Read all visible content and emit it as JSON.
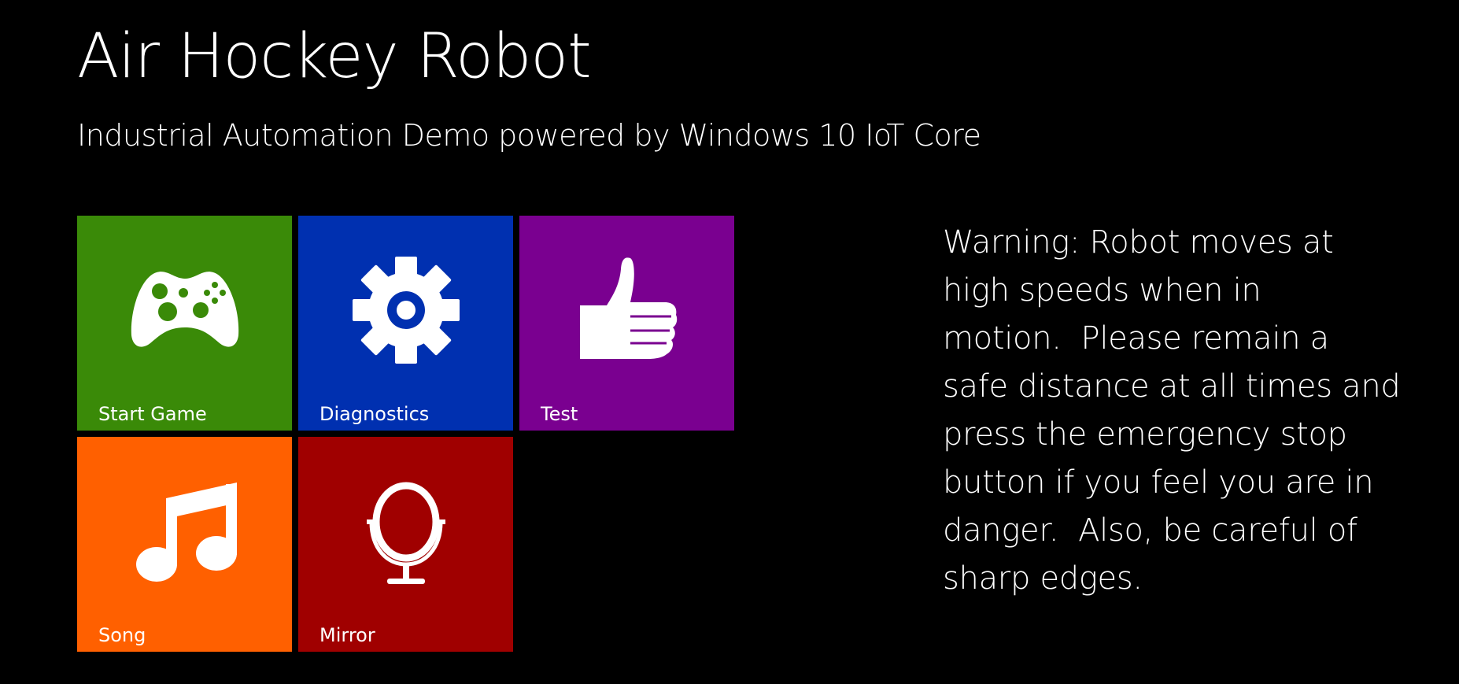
{
  "header": {
    "title": "Air Hockey Robot",
    "subtitle": "Industrial Automation Demo powered by Windows 10 IoT Core"
  },
  "tiles": [
    {
      "label": "Start Game",
      "icon": "gamepad-icon",
      "color": "#3a8a08"
    },
    {
      "label": "Diagnostics",
      "icon": "gear-icon",
      "color": "#0030b0"
    },
    {
      "label": "Test",
      "icon": "thumbs-up-icon",
      "color": "#7a0090"
    },
    {
      "label": "Song",
      "icon": "music-note-icon",
      "color": "#ff6000"
    },
    {
      "label": "Mirror",
      "icon": "mirror-icon",
      "color": "#a00000"
    }
  ],
  "warning": {
    "text": "Warning: Robot moves at\nhigh speeds when in\nmotion.  Please remain a\nsafe distance at all times and\npress the emergency stop\nbutton if you feel you are in\ndanger.  Also, be careful of\nsharp edges."
  },
  "colors": {
    "background": "#000000",
    "text": "#ffffff"
  }
}
